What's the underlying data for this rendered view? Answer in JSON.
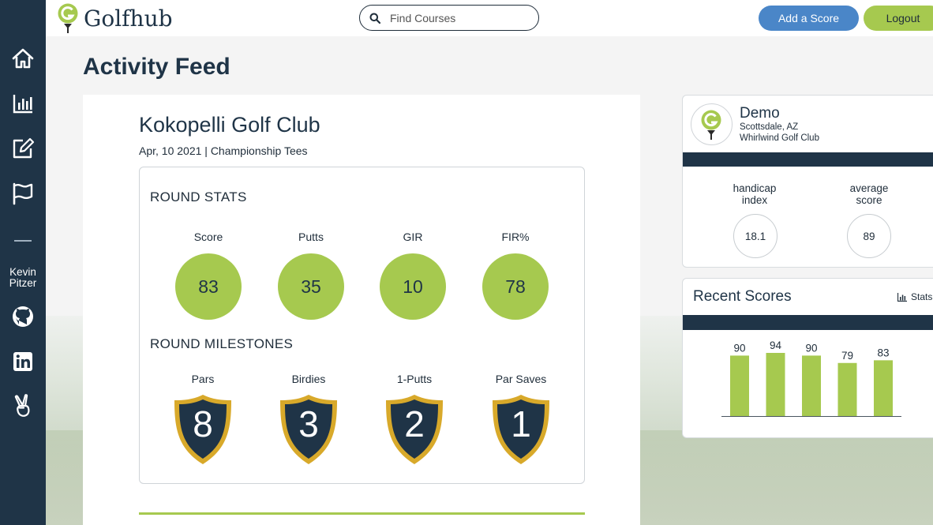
{
  "app": {
    "logo_text": "Golfhub"
  },
  "header": {
    "search_placeholder": "Find Courses",
    "add_score_label": "Add a Score",
    "logout_label": "Logout"
  },
  "sidebar": {
    "items": [
      {
        "icon": "home-icon"
      },
      {
        "icon": "bar-chart-icon"
      },
      {
        "icon": "edit-icon"
      },
      {
        "icon": "flag-icon"
      }
    ],
    "user_first": "Kevin",
    "user_last": "Pitzer",
    "social": [
      {
        "icon": "github-icon"
      },
      {
        "icon": "linkedin-icon"
      },
      {
        "icon": "peace-hand-icon"
      }
    ]
  },
  "page_title": "Activity Feed",
  "round": {
    "course": "Kokopelli Golf Club",
    "meta": "Apr, 10 2021 | Championship Tees",
    "stats_title": "ROUND STATS",
    "stats": [
      {
        "label": "Score",
        "value": "83"
      },
      {
        "label": "Putts",
        "value": "35"
      },
      {
        "label": "GIR",
        "value": "10"
      },
      {
        "label": "FIR%",
        "value": "78"
      }
    ],
    "milestones_title": "ROUND MILESTONES",
    "milestones": [
      {
        "label": "Pars",
        "value": "8"
      },
      {
        "label": "Birdies",
        "value": "3"
      },
      {
        "label": "1-Putts",
        "value": "2"
      },
      {
        "label": "Par Saves",
        "value": "1"
      }
    ]
  },
  "profile": {
    "name": "Demo",
    "location": "Scottsdale, AZ",
    "club": "Whirlwind Golf Club",
    "handicap_label_1": "handicap",
    "handicap_label_2": "index",
    "handicap_value": "18.1",
    "average_label_1": "average",
    "average_label_2": "score",
    "average_value": "89"
  },
  "recent": {
    "title": "Recent Scores",
    "stats_link": "Stats"
  },
  "colors": {
    "navy": "#1f3447",
    "green": "#a6c94f",
    "blue": "#4a86c8",
    "gold": "#d8a92a"
  },
  "chart_data": {
    "type": "bar",
    "categories": [
      "",
      "",
      "",
      "",
      ""
    ],
    "values": [
      90,
      94,
      90,
      79,
      83
    ],
    "title": "",
    "xlabel": "",
    "ylabel": "",
    "ylim": [
      0,
      100
    ],
    "grid": false
  }
}
